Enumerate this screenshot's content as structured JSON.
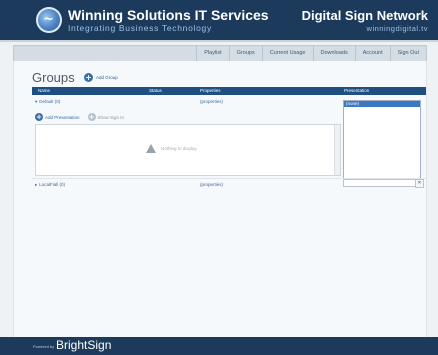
{
  "header": {
    "company_title": "Winning Solutions IT Services",
    "company_subtitle": "Integrating Business Technology",
    "network_title": "Digital Sign Network",
    "network_subtitle": "winningdigital.tv"
  },
  "nav": {
    "items": [
      "Playlist",
      "Groups",
      "Current Usage",
      "Downloads",
      "Account",
      "Sign Out"
    ]
  },
  "page": {
    "title": "Groups",
    "add_group_label": "Add Group"
  },
  "table": {
    "columns": [
      "Name",
      "Status",
      "Properties",
      "Presentation"
    ],
    "rows": [
      {
        "name": "Default (0)",
        "properties": "(properties)",
        "add_presentation_label": "Add Presentation",
        "secondary_action_label": "Show Sign In",
        "preview_message": "Nothing to display",
        "presentation_selected": "(none)"
      },
      {
        "name": "LocalFiall (0)",
        "properties": "(properties)"
      }
    ]
  },
  "footer": {
    "powered_by": "Powered by",
    "logo": "BrightSign"
  },
  "colors": {
    "header_bg": "#1b3a5c",
    "table_header_bg": "#1f4f80",
    "selection": "#3a78c2",
    "link": "#3a6a9b"
  }
}
